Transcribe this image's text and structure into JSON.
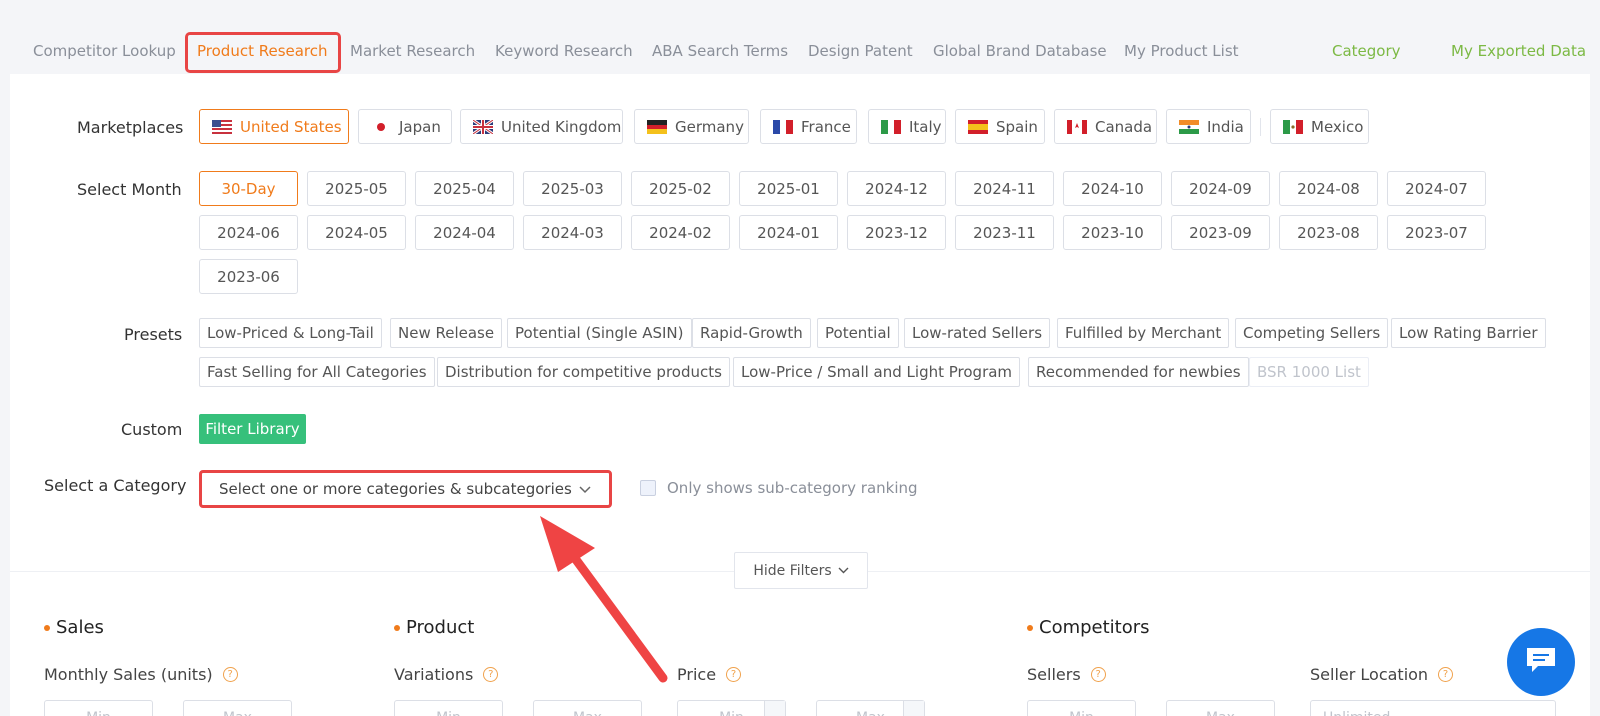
{
  "nav": {
    "tabs": [
      "Competitor Lookup",
      "Product Research",
      "Market Research",
      "Keyword Research",
      "ABA Search Terms",
      "Design Patent",
      "Global Brand Database",
      "My Product List"
    ],
    "right_links": [
      "Category",
      "My Exported Data"
    ]
  },
  "labels": {
    "marketplaces": "Marketplaces",
    "select_month": "Select Month",
    "presets": "Presets",
    "custom": "Custom",
    "select_category": "Select a Category"
  },
  "marketplaces": [
    "United States",
    "Japan",
    "United Kingdom",
    "Germany",
    "France",
    "Italy",
    "Spain",
    "Canada",
    "India",
    "Mexico"
  ],
  "months": [
    "30-Day",
    "2025-05",
    "2025-04",
    "2025-03",
    "2025-02",
    "2025-01",
    "2024-12",
    "2024-11",
    "2024-10",
    "2024-09",
    "2024-08",
    "2024-07",
    "2024-06",
    "2024-05",
    "2024-04",
    "2024-03",
    "2024-02",
    "2024-01",
    "2023-12",
    "2023-11",
    "2023-10",
    "2023-09",
    "2023-08",
    "2023-07",
    "2023-06"
  ],
  "presets": [
    "Low-Priced & Long-Tail",
    "New Release",
    "Potential (Single ASIN)",
    "Rapid-Growth",
    "Potential",
    "Low-rated Sellers",
    "Fulfilled by Merchant",
    "Competing Sellers",
    "Low Rating Barrier",
    "Fast Selling for All Categories",
    "Distribution for competitive products",
    "Low-Price / Small and Light Program",
    "Recommended for newbies",
    "BSR 1000 List"
  ],
  "custom": {
    "filter_library": "Filter Library"
  },
  "category": {
    "placeholder": "Select one or more categories & subcategories",
    "checkbox_label": "Only shows sub-category ranking"
  },
  "hide_filters": "Hide Filters",
  "sections": {
    "sales": "Sales",
    "product": "Product",
    "competitors": "Competitors"
  },
  "fields": {
    "monthly_sales": "Monthly Sales (units)",
    "variations": "Variations",
    "price": "Price",
    "sellers": "Sellers",
    "seller_location": "Seller Location"
  },
  "inputs": {
    "min": "Min",
    "max": "Max",
    "unlimited": "Unlimited"
  },
  "colors": {
    "accent": "#f07b1b",
    "green": "#36c07b",
    "highlight": "#e84545",
    "chat": "#1677e6"
  }
}
